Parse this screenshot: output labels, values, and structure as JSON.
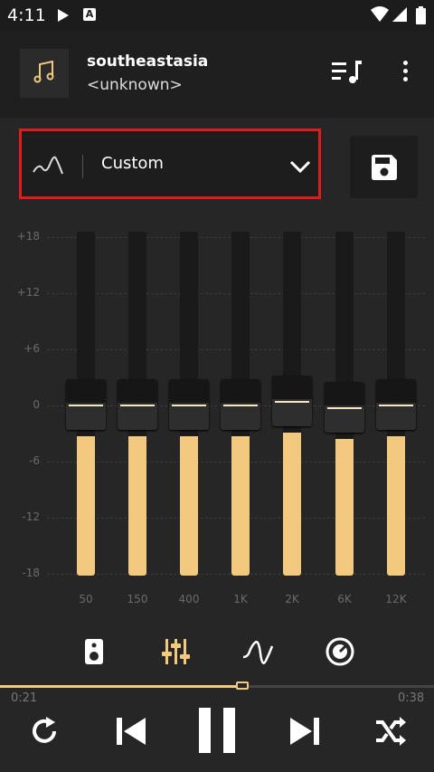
{
  "status_bar": {
    "time": "4:11",
    "notification_badge": "A"
  },
  "now_playing": {
    "title": "southeastasia",
    "artist": "<unknown>",
    "album_art_icon": "music-note-icon"
  },
  "header_actions": {
    "queue_icon": "queue-music-icon",
    "more_icon": "more-vert-icon"
  },
  "preset": {
    "label": "Custom",
    "icon": "eq-curve-icon",
    "dropdown_icon": "chevron-down-icon",
    "save_icon": "save-icon"
  },
  "equalizer": {
    "db_scale": [
      "+18",
      "+12",
      "+6",
      "0",
      "-6",
      "-12",
      "-18"
    ],
    "bands": [
      {
        "freq": "50",
        "gain_db": 0
      },
      {
        "freq": "150",
        "gain_db": 0
      },
      {
        "freq": "400",
        "gain_db": 0
      },
      {
        "freq": "1K",
        "gain_db": 0
      },
      {
        "freq": "2K",
        "gain_db": 0.4
      },
      {
        "freq": "6K",
        "gain_db": -0.3
      },
      {
        "freq": "12K",
        "gain_db": 0
      }
    ],
    "gain_range_db": [
      -18,
      18
    ]
  },
  "tabs": [
    {
      "name": "speaker",
      "icon": "speaker-icon",
      "active": false
    },
    {
      "name": "equalizer",
      "icon": "equalizer-sliders-icon",
      "active": true
    },
    {
      "name": "effects",
      "icon": "wave-icon",
      "active": false
    },
    {
      "name": "bass",
      "icon": "knob-icon",
      "active": false
    }
  ],
  "playback": {
    "current_time": "0:21",
    "total_time": "0:38",
    "progress": 0.56
  },
  "controls": {
    "repeat_icon": "repeat-icon",
    "previous_icon": "skip-previous-icon",
    "play_pause_icon": "pause-icon",
    "next_icon": "skip-next-icon",
    "shuffle_icon": "shuffle-icon"
  },
  "colors": {
    "accent": "#f3c97f",
    "highlight_border": "#e01c1c",
    "background": "#262626"
  }
}
